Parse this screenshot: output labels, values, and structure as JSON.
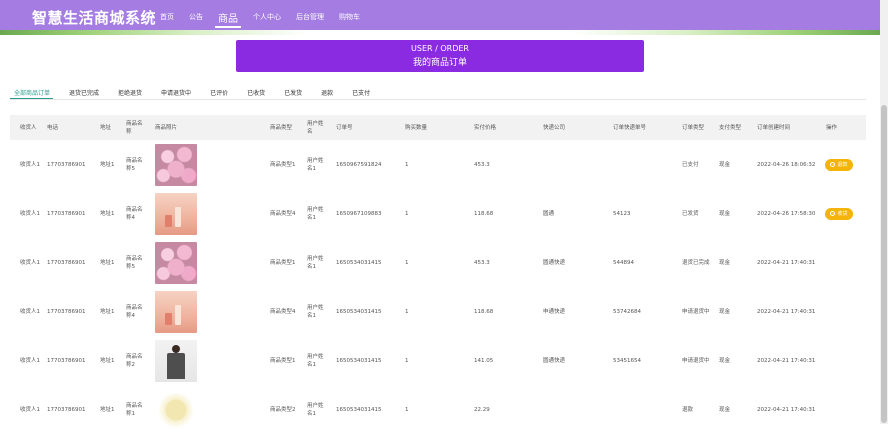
{
  "header": {
    "site_title": "智慧生活商城系统",
    "nav": [
      "首页",
      "公告",
      "商品",
      "个人中心",
      "后台管理",
      "购物车"
    ],
    "active_nav": "商品"
  },
  "banner": {
    "line1": "USER / ORDER",
    "line2": "我的商品订单"
  },
  "tabs": [
    "全部商品订单",
    "退货已完成",
    "拒绝退货",
    "申请退货中",
    "已评价",
    "已收货",
    "已发货",
    "退款",
    "已支付"
  ],
  "active_tab": "全部商品订单",
  "table": {
    "headers": [
      "收货人",
      "电话",
      "地址",
      "商品名称",
      "商品照片",
      "商品类型",
      "用户姓名",
      "订单号",
      "购买数量",
      "实付价格",
      "快递公司",
      "订单快递单号",
      "订单类型",
      "支付类型",
      "订单创建时间",
      "操作"
    ],
    "rows": [
      {
        "receiver": "收货人1",
        "phone": "17703786901",
        "address": "地址1",
        "product": "商品名称5",
        "image": "roses",
        "type": "商品类型1",
        "user": "用户姓名1",
        "order_no": "1650967591824",
        "qty": "1",
        "price": "453.3",
        "courier": "",
        "tracking": "",
        "status": "已支付",
        "pay": "现金",
        "created": "2022-04-26 18:06:32",
        "action": "退款"
      },
      {
        "receiver": "收货人1",
        "phone": "17703786901",
        "address": "地址1",
        "product": "商品名称4",
        "image": "cosmetics",
        "type": "商品类型4",
        "user": "用户姓名1",
        "order_no": "1650967109883",
        "qty": "1",
        "price": "118.68",
        "courier": "圆通",
        "tracking": "54123",
        "status": "已发货",
        "pay": "现金",
        "created": "2022-04-26 17:58:30",
        "action": "收货"
      },
      {
        "receiver": "收货人1",
        "phone": "17703786901",
        "address": "地址1",
        "product": "商品名称5",
        "image": "roses",
        "type": "商品类型1",
        "user": "用户姓名1",
        "order_no": "1650534031415",
        "qty": "1",
        "price": "453.3",
        "courier": "圆通快递",
        "tracking": "544894",
        "status": "退货已完成",
        "pay": "现金",
        "created": "2022-04-21 17:40:31",
        "action": ""
      },
      {
        "receiver": "收货人1",
        "phone": "17703786901",
        "address": "地址1",
        "product": "商品名称4",
        "image": "cosmetics",
        "type": "商品类型4",
        "user": "用户姓名1",
        "order_no": "1650534031415",
        "qty": "1",
        "price": "118.68",
        "courier": "申通快递",
        "tracking": "53742684",
        "status": "申请退货中",
        "pay": "现金",
        "created": "2022-04-21 17:40:31",
        "action": ""
      },
      {
        "receiver": "收货人1",
        "phone": "17703786901",
        "address": "地址1",
        "product": "商品名称2",
        "image": "person",
        "type": "商品类型1",
        "user": "用户姓名1",
        "order_no": "1650534031415",
        "qty": "1",
        "price": "141.05",
        "courier": "圆通快递",
        "tracking": "53451654",
        "status": "申请退货中",
        "pay": "现金",
        "created": "2022-04-21 17:40:31",
        "action": ""
      },
      {
        "receiver": "收货人1",
        "phone": "17703786901",
        "address": "地址1",
        "product": "商品名称1",
        "image": "flower",
        "type": "商品类型2",
        "user": "用户姓名1",
        "order_no": "1650534031415",
        "qty": "1",
        "price": "22.29",
        "courier": "",
        "tracking": "",
        "status": "退款",
        "pay": "现金",
        "created": "2022-04-21 17:40:31",
        "action": ""
      }
    ]
  },
  "colors": {
    "header": "#a47ce2",
    "banner": "#8a2be2",
    "accent": "#2a9d8f",
    "button": "#f5b40a"
  }
}
